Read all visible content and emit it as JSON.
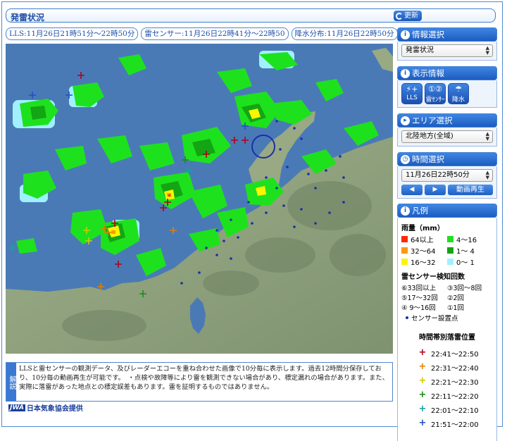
{
  "header": {
    "title": "発雷状況",
    "refresh_label": "更新"
  },
  "time_labels": [
    "LLS:11月26日21時51分～22時50分",
    "雷センサー:11月26日22時41分～22時50",
    "降水分布:11月26日22時50分"
  ],
  "info_panel": {
    "title": "情報選択",
    "selected": "発雷状況"
  },
  "display_panel": {
    "title": "表示情報",
    "buttons": [
      {
        "label": "LLS",
        "glyph": "⚡+"
      },
      {
        "label": "雷ｾﾝｻｰ",
        "glyph": "①②"
      },
      {
        "label": "降水",
        "glyph": "☂"
      }
    ]
  },
  "area_panel": {
    "title": "エリア選択",
    "selected": "北陸地方(全域)"
  },
  "time_panel": {
    "title": "時間選択",
    "selected": "11月26日22時50分",
    "prev_label": "◀",
    "next_label": "▶",
    "play_label": "動画再生"
  },
  "legend": {
    "title": "凡例",
    "rain_title": "雨量（mm）",
    "rain_items": [
      {
        "label": "64以上",
        "color": "#ff2800"
      },
      {
        "label": "4～16",
        "color": "#1ee11e"
      },
      {
        "label": "32～64",
        "color": "#ff9900"
      },
      {
        "label": "1～ 4",
        "color": "#13a513"
      },
      {
        "label": "16～32",
        "color": "#faf500"
      },
      {
        "label": "0～ 1",
        "color": "#a0f0ff"
      }
    ],
    "sensor_title": "雷センサー検知回数",
    "sensor_items": [
      "⑥33回以上",
      "③3回～8回",
      "⑤17～32回",
      "②2回",
      "④ 9～16回",
      "①1回"
    ],
    "sensor_point": "センサー設置点",
    "time_legend_title": "時間帯別落雷位置",
    "time_items": [
      {
        "label": "22:41～22:50",
        "color": "#b0001a"
      },
      {
        "label": "22:31～22:40",
        "color": "#e08000"
      },
      {
        "label": "22:21～22:30",
        "color": "#d0c800"
      },
      {
        "label": "22:11～22:20",
        "color": "#1a8a1a"
      },
      {
        "label": "22:01～22:10",
        "color": "#1aa0a0"
      },
      {
        "label": "21:51～22:00",
        "color": "#2050c0"
      }
    ]
  },
  "explanation": {
    "tab_label": "解説",
    "text": "LLSと雷センサーの観測データ、及びレーダーエコーを重ね合わせた画像で10分毎に表示します。過去12時間分保存しており、10分毎の動画再生が可能です。　・点検や故障等により雷を観測できない場合があり、標定漏れの場合があります。また、実際に落雷があった地点との標定誤差もあります。雷を証明するものではありません。"
  },
  "footer": {
    "logo_mark": "JWA",
    "logo_text": "日本気象協会提供"
  }
}
